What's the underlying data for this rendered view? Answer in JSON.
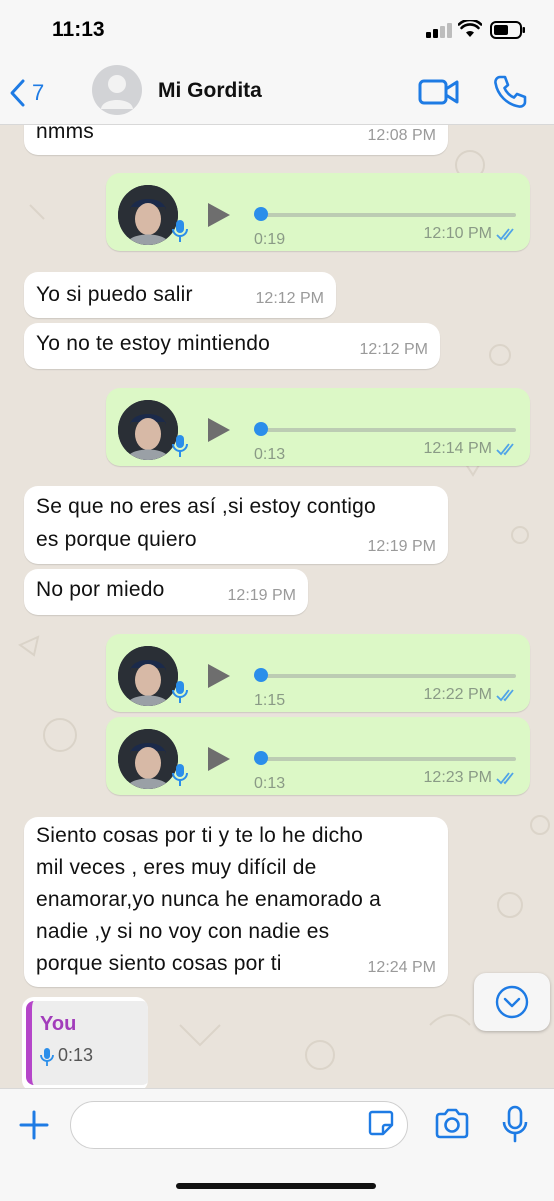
{
  "status": {
    "time": "11:13"
  },
  "header": {
    "back_count": "7",
    "contact_name": "Mi Gordita"
  },
  "messages": [
    {
      "dir": "in",
      "type": "text",
      "text": "nmms",
      "time": "12:08 PM"
    },
    {
      "dir": "out",
      "type": "voice",
      "duration": "0:19",
      "time": "12:10 PM",
      "read": true
    },
    {
      "dir": "in",
      "type": "text",
      "text": "Yo si puedo salir",
      "time": "12:12 PM"
    },
    {
      "dir": "in",
      "type": "text",
      "text": "Yo no te estoy mintiendo",
      "time": "12:12 PM"
    },
    {
      "dir": "out",
      "type": "voice",
      "duration": "0:13",
      "time": "12:14 PM",
      "read": true
    },
    {
      "dir": "in",
      "type": "text",
      "lines": [
        "Se que no eres así  ,si estoy contigo",
        "es porque quiero"
      ],
      "time": "12:19 PM"
    },
    {
      "dir": "in",
      "type": "text",
      "text": "No por miedo",
      "time": "12:19 PM"
    },
    {
      "dir": "out",
      "type": "voice",
      "duration": "1:15",
      "time": "12:22 PM",
      "read": true
    },
    {
      "dir": "out",
      "type": "voice",
      "duration": "0:13",
      "time": "12:23 PM",
      "read": true
    },
    {
      "dir": "in",
      "type": "text",
      "lines": [
        "Siento cosas por ti y te lo he dicho",
        "mil veces , eres muy difícil de",
        "enamorar,yo nunca he enamorado a",
        "nadie ,y si no voy con nadie es",
        "porque siento cosas por ti"
      ],
      "time": "12:24 PM"
    }
  ],
  "reply_preview": {
    "author": "You",
    "duration": "0:13"
  },
  "colors": {
    "accent": "#1E7BE4",
    "outgoing": "#DCF8C6",
    "incoming": "#FFFFFF",
    "read_ticks": "#4FA3E8",
    "reply_author": "#A23CBB"
  }
}
